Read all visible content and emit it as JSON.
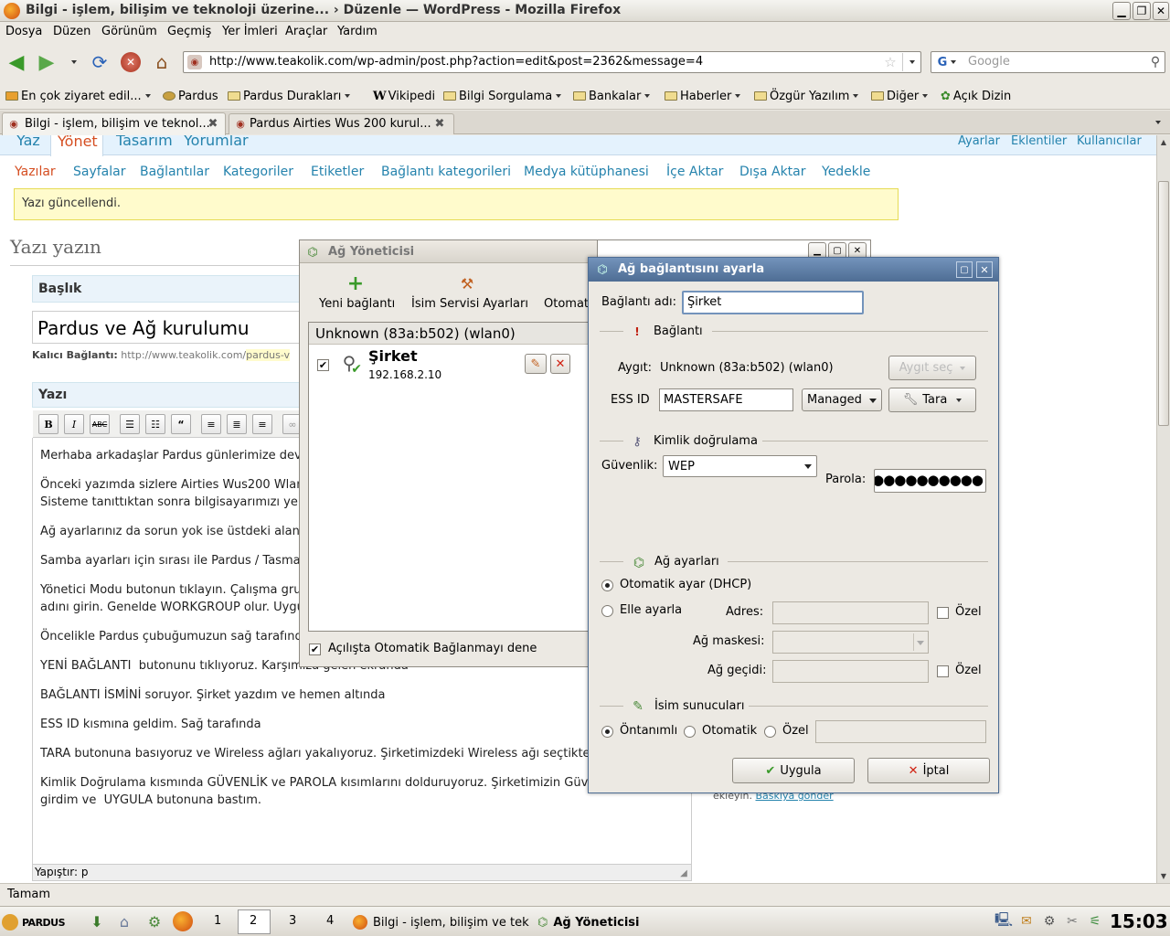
{
  "window": {
    "title": "Bilgi - işlem, bilişim ve teknoloji üzerine... › Düzenle — WordPress - Mozilla Firefox"
  },
  "menu": [
    "Dosya",
    "Düzen",
    "Görünüm",
    "Geçmiş",
    "Yer İmleri",
    "Araçlar",
    "Yardım"
  ],
  "nav": {
    "url": "http://www.teakolik.com/wp-admin/post.php?action=edit&post=2362&message=4",
    "search_placeholder": "Google"
  },
  "bookmarks": [
    "En çok ziyaret edil...",
    "Pardus",
    "Pardus Durakları",
    "Vikipedi",
    "Bilgi Sorgulama",
    "Bankalar",
    "Haberler",
    "Özgür Yazılım",
    "Diğer",
    "Açık Dizin"
  ],
  "tabs": [
    "Bilgi - işlem, bilişim ve teknol...",
    "Pardus Airties Wus 200 kurul..."
  ],
  "wp": {
    "top_nav": [
      "Yaz",
      "Yönet",
      "Tasarım",
      "Yorumlar"
    ],
    "top_right": [
      "Ayarlar",
      "Eklentiler",
      "Kullanıcılar"
    ],
    "sub_nav": [
      "Yazılar",
      "Sayfalar",
      "Bağlantılar",
      "Kategoriler",
      "Etiketler",
      "Bağlantı kategorileri",
      "Medya kütüphanesi",
      "İçe Aktar",
      "Dışa Aktar",
      "Yedekle"
    ],
    "notice": "Yazı güncellendi.",
    "page_heading": "Yazı yazın",
    "title_label": "Başlık",
    "title_value": "Pardus ve Ağ kurulumu",
    "permalink_label": "Kalıcı Bağlantı:",
    "permalink_url": "http://www.teakolik.com/",
    "permalink_slug": "pardus-v",
    "body_label": "Yazı",
    "paragraphs": [
      "Merhaba arkadaşlar Pardus günlerimize deva",
      "Önceki yazımda sizlere Airties Wus200 Wlan",
      "Sisteme tanıttıktan sonra bilgisayarımızı yen",
      "Ağ ayarlarınız da sorun yok ise üstdeki aland",
      "Samba ayarları için sırası ile Pardus / Tasma /",
      "Yönetici Modu butonun tıklayın. Çalışma grub",
      "adını girin. Genelde WORKGROUP olur. Uygula",
      "Öncelikle Pardus çubuğumuzun sağ tarafında",
      "YENİ BAĞLANTI  butonunu tıklıyoruz. Karşımıza gelen ekranda",
      "BAĞLANTI İSMİNİ soruyor. Şirket yazdım ve hemen altında",
      "ESS ID kısmına geldim. Sağ tarafında",
      "TARA butonuna basıyoruz ve Wireless ağları yakalıyoruz. Şirketimizdeki Wireless ağı seçtikten s",
      "Kimlik Doğrulama kısmında GÜVENLİK ve PAROLA kısımlarını dolduruyoruz. Şirketimizin Güvenl",
      "girdim ve  UYGULA butonuna bastım."
    ],
    "path_label": "Yapıştır: p",
    "side_text": "ekleyin.",
    "side_link": "Baskıya gönder"
  },
  "netmgr": {
    "title": "Ağ Yöneticisi",
    "toolbar": [
      "Yeni bağlantı",
      "İsim Servisi Ayarları",
      "Otomat"
    ],
    "device": "Unknown (83a:b502) (wlan0)",
    "conn_name": "Şirket",
    "conn_ip": "192.168.2.10",
    "auto_label": "Açılışta Otomatik Bağlanmayı dene"
  },
  "dialog": {
    "title": "Ağ bağlantısını ayarla",
    "name_label": "Bağlantı adı:",
    "name_value": "Şirket",
    "sec_connection": "Bağlantı",
    "device_label": "Aygıt:",
    "device_value": "Unknown (83a:b502) (wlan0)",
    "device_select": "Aygıt seç",
    "essid_label": "ESS ID",
    "essid_value": "MASTERSAFE",
    "mode_value": "Managed",
    "scan_label": "Tara",
    "sec_auth": "Kimlik doğrulama",
    "security_label": "Güvenlik:",
    "security_value": "WEP",
    "password_label": "Parola:",
    "password_value": "●●●●●●●●●●●",
    "sec_net": "Ağ ayarları",
    "auto_dhcp": "Otomatik ayar (DHCP)",
    "manual": "Elle ayarla",
    "address_label": "Adres:",
    "netmask_label": "Ağ maskesi:",
    "gateway_label": "Ağ geçidi:",
    "custom": "Özel",
    "sec_dns": "İsim sunucuları",
    "dns_default": "Öntanımlı",
    "dns_auto": "Otomatik",
    "dns_custom": "Özel",
    "apply": "Uygula",
    "cancel": "İptal"
  },
  "status": {
    "text": "Tamam"
  },
  "taskbar": {
    "logo": "PARDUS",
    "desktops": [
      "1",
      "2",
      "3",
      "4"
    ],
    "tasks": [
      "Bilgi - işlem, bilişim ve tekn",
      "Ağ Yöneticisi"
    ],
    "clock": "15:03"
  },
  "colors": {
    "wp_link": "#2583ad",
    "notice_bg": "#fffbcc",
    "dialog_title": "#4e6d94"
  }
}
